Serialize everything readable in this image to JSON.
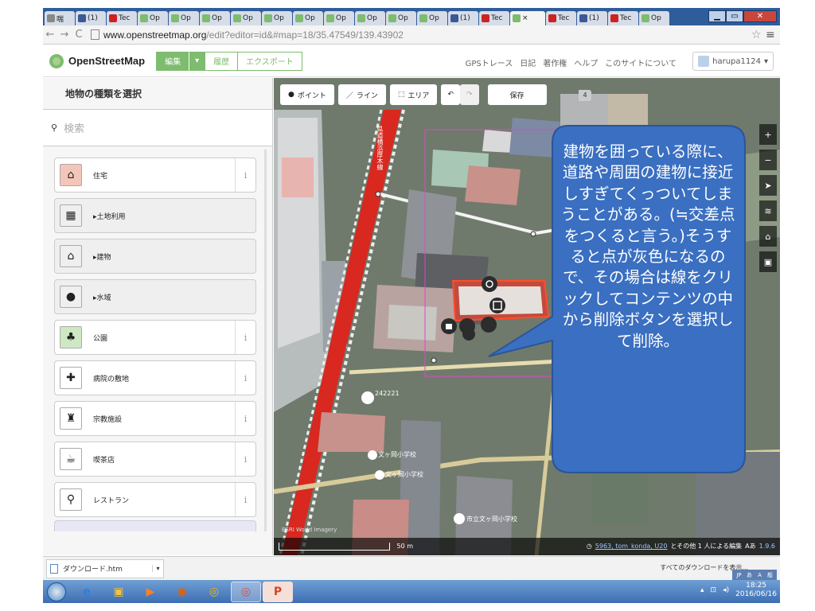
{
  "browser": {
    "tabs": [
      {
        "label": "喘",
        "icon": "page-icon",
        "color": "#888888"
      },
      {
        "label": "(1)",
        "icon": "facebook-icon",
        "color": "#3b5998"
      },
      {
        "label": "Tec",
        "icon": "opera-icon",
        "color": "#cc2222"
      },
      {
        "label": "Op",
        "icon": "osm-icon",
        "color": "#7ebc6f"
      },
      {
        "label": "Op",
        "icon": "osm-icon",
        "color": "#7ebc6f"
      },
      {
        "label": "Op",
        "icon": "osm-icon",
        "color": "#7ebc6f"
      },
      {
        "label": "Op",
        "icon": "osm-icon",
        "color": "#7ebc6f"
      },
      {
        "label": "Op",
        "icon": "osm-icon",
        "color": "#7ebc6f"
      },
      {
        "label": "Op",
        "icon": "osm-icon",
        "color": "#7ebc6f"
      },
      {
        "label": "Op",
        "icon": "osm-icon",
        "color": "#7ebc6f"
      },
      {
        "label": "Op",
        "icon": "osm-icon",
        "color": "#7ebc6f"
      },
      {
        "label": "Op",
        "icon": "osm-icon",
        "color": "#7ebc6f"
      },
      {
        "label": "Op",
        "icon": "osm-icon",
        "color": "#7ebc6f"
      },
      {
        "label": "(1)",
        "icon": "facebook-icon",
        "color": "#3b5998"
      },
      {
        "label": "Tec",
        "icon": "opera-icon",
        "color": "#cc2222"
      },
      {
        "label": "×",
        "icon": "osm-icon",
        "color": "#7ebc6f",
        "active": true
      },
      {
        "label": "Tec",
        "icon": "opera-icon",
        "color": "#cc2222"
      },
      {
        "label": "(1)",
        "icon": "facebook-icon",
        "color": "#3b5998"
      },
      {
        "label": "Tec",
        "icon": "opera-icon",
        "color": "#cc2222"
      },
      {
        "label": "Op",
        "icon": "osm-icon",
        "color": "#7ebc6f"
      }
    ],
    "url_host": "www.openstreetmap.org",
    "url_path": "/edit?editor=id&#map=18/35.47549/139.43902",
    "back": "←",
    "forward": "→",
    "reload": "C",
    "star": "☆",
    "menu": "≡"
  },
  "osm": {
    "logo": "OpenStreetMap",
    "edit": "編集",
    "edit_arrow": "▾",
    "history": "履歴",
    "export": "エクスポート",
    "links": [
      "GPSトレース",
      "日記",
      "著作権",
      "ヘルプ",
      "このサイトについて"
    ],
    "user": "harupa1124",
    "user_arrow": "▾"
  },
  "sidebar": {
    "title": "地物の種類を選択",
    "search_placeholder": "検索",
    "presets": [
      {
        "label": "住宅",
        "icon": "house-icon",
        "glyph": "⌂",
        "info": "i",
        "bg": "#f4c5b9"
      },
      {
        "label": "▸土地利用",
        "icon": "landuse-icon",
        "glyph": "▦",
        "category": true
      },
      {
        "label": "▸建物",
        "icon": "building-icon",
        "glyph": "⌂",
        "category": true
      },
      {
        "label": "▸水域",
        "icon": "water-drop-icon",
        "glyph": "●",
        "category": true
      },
      {
        "label": "公園",
        "icon": "tree-icon",
        "glyph": "♣",
        "info": "i",
        "bg": "#cfe8c4"
      },
      {
        "label": "病院の敷地",
        "icon": "hospital-cross-icon",
        "glyph": "✚",
        "info": "i"
      },
      {
        "label": "宗教施設",
        "icon": "place-of-worship-icon",
        "glyph": "♜",
        "info": "i"
      },
      {
        "label": "喫茶店",
        "icon": "cafe-cup-icon",
        "glyph": "☕",
        "info": "i"
      },
      {
        "label": "レストラン",
        "icon": "restaurant-icon",
        "glyph": "⚲",
        "info": "i"
      }
    ]
  },
  "map": {
    "tools": [
      {
        "label": "ポイント",
        "icon": "point-icon",
        "glyph": "⬤"
      },
      {
        "label": "ライン",
        "icon": "line-icon",
        "glyph": "／"
      },
      {
        "label": "エリア",
        "icon": "area-icon",
        "glyph": "⬚"
      }
    ],
    "undo": "↶",
    "redo": "↷",
    "save": "保存",
    "save_count": "4",
    "side_controls": [
      "+",
      "−",
      "➤",
      "≋",
      "⌂",
      "▣"
    ],
    "labels": [
      {
        "text": "242221",
        "icon": "bus-stop-icon"
      },
      {
        "text": "文ヶ岡小学校",
        "icon": "school-pin-icon"
      },
      {
        "text": "文ヶ岡小学校",
        "icon": "school-pin-icon"
      },
      {
        "text": "市立文ヶ岡小学校",
        "icon": "school-icon"
      }
    ],
    "road_label": "県道横浜厚木線",
    "image_credit": "ESRI World Imagery",
    "scale_label": "50 m",
    "attribution_link": "5963, tom_konda, U20",
    "attribution_rest": "とその他 1 人による編集",
    "brand": "Aあ",
    "version": "1.9.6",
    "balloon_text": "建物を囲っている際に、道路や周囲の建物に接近しすぎてくっついてしまうことがある。(≒交差点をつくると言う。)そうすると点が灰色になるので、その場合は線をクリックしてコンテンツの中から削除ボタンを選択して削除。",
    "balloon_color": "#3a6fc1"
  },
  "download": {
    "filename": "ダウンロード.htm",
    "arrow": "▾",
    "show_all": "すべてのダウンロードを表示..."
  },
  "taskbar": {
    "time": "18:25",
    "date": "2016/06/16",
    "ime_labels": [
      "JP",
      "あ",
      "A",
      "般"
    ]
  }
}
